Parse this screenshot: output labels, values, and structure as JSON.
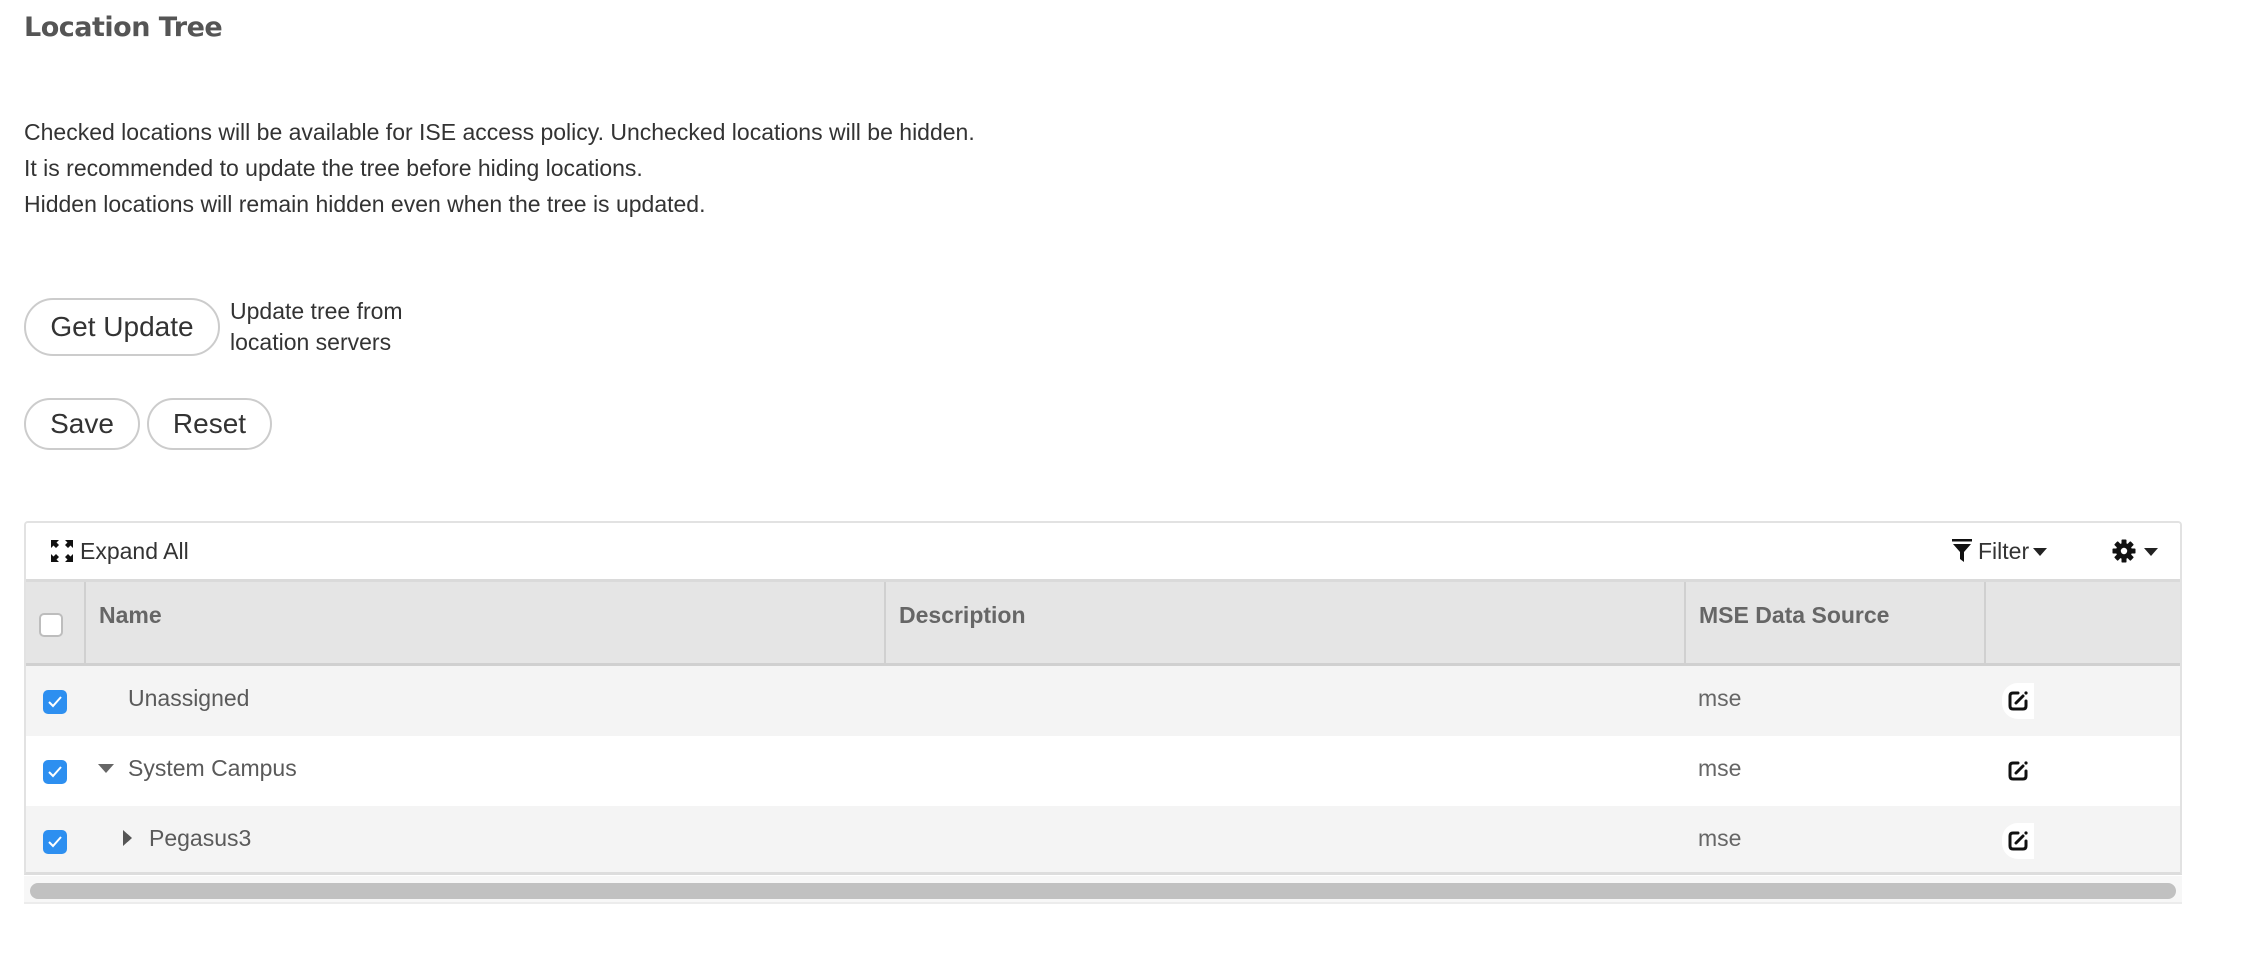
{
  "page": {
    "title": "Location Tree",
    "info_lines": [
      "Checked locations will be available for ISE access policy. Unchecked locations will be hidden.",
      "It is recommended to update the tree before hiding locations.",
      "Hidden locations will remain hidden even when the tree is updated."
    ]
  },
  "actions": {
    "get_update_label": "Get Update",
    "get_update_hint_lines": [
      "Update tree from",
      "location servers"
    ],
    "save_label": "Save",
    "reset_label": "Reset"
  },
  "toolbar": {
    "expand_all_label": "Expand All",
    "expand_icon": "expand-arrows-icon",
    "filter_label": "Filter",
    "filter_icon": "funnel-icon",
    "settings_icon": "gear-icon"
  },
  "table": {
    "columns": [
      "Name",
      "Description",
      "MSE Data Source",
      ""
    ],
    "select_all_checked": false,
    "rows": [
      {
        "name": "Unassigned",
        "description": "",
        "mse_data_source": "mse",
        "checked": true,
        "tree_state": "leaf",
        "level": 0
      },
      {
        "name": "System Campus",
        "description": "",
        "mse_data_source": "mse",
        "checked": true,
        "tree_state": "expanded",
        "level": 0
      },
      {
        "name": "Pegasus3",
        "description": "",
        "mse_data_source": "mse",
        "checked": true,
        "tree_state": "collapsed",
        "level": 1
      }
    ]
  },
  "colors": {
    "checkbox_checked": "#2d8ff0",
    "header_bg": "#e5e5e5",
    "row_alt_bg": "#f4f4f4",
    "scrollbar_thumb": "#c1c1c1"
  }
}
